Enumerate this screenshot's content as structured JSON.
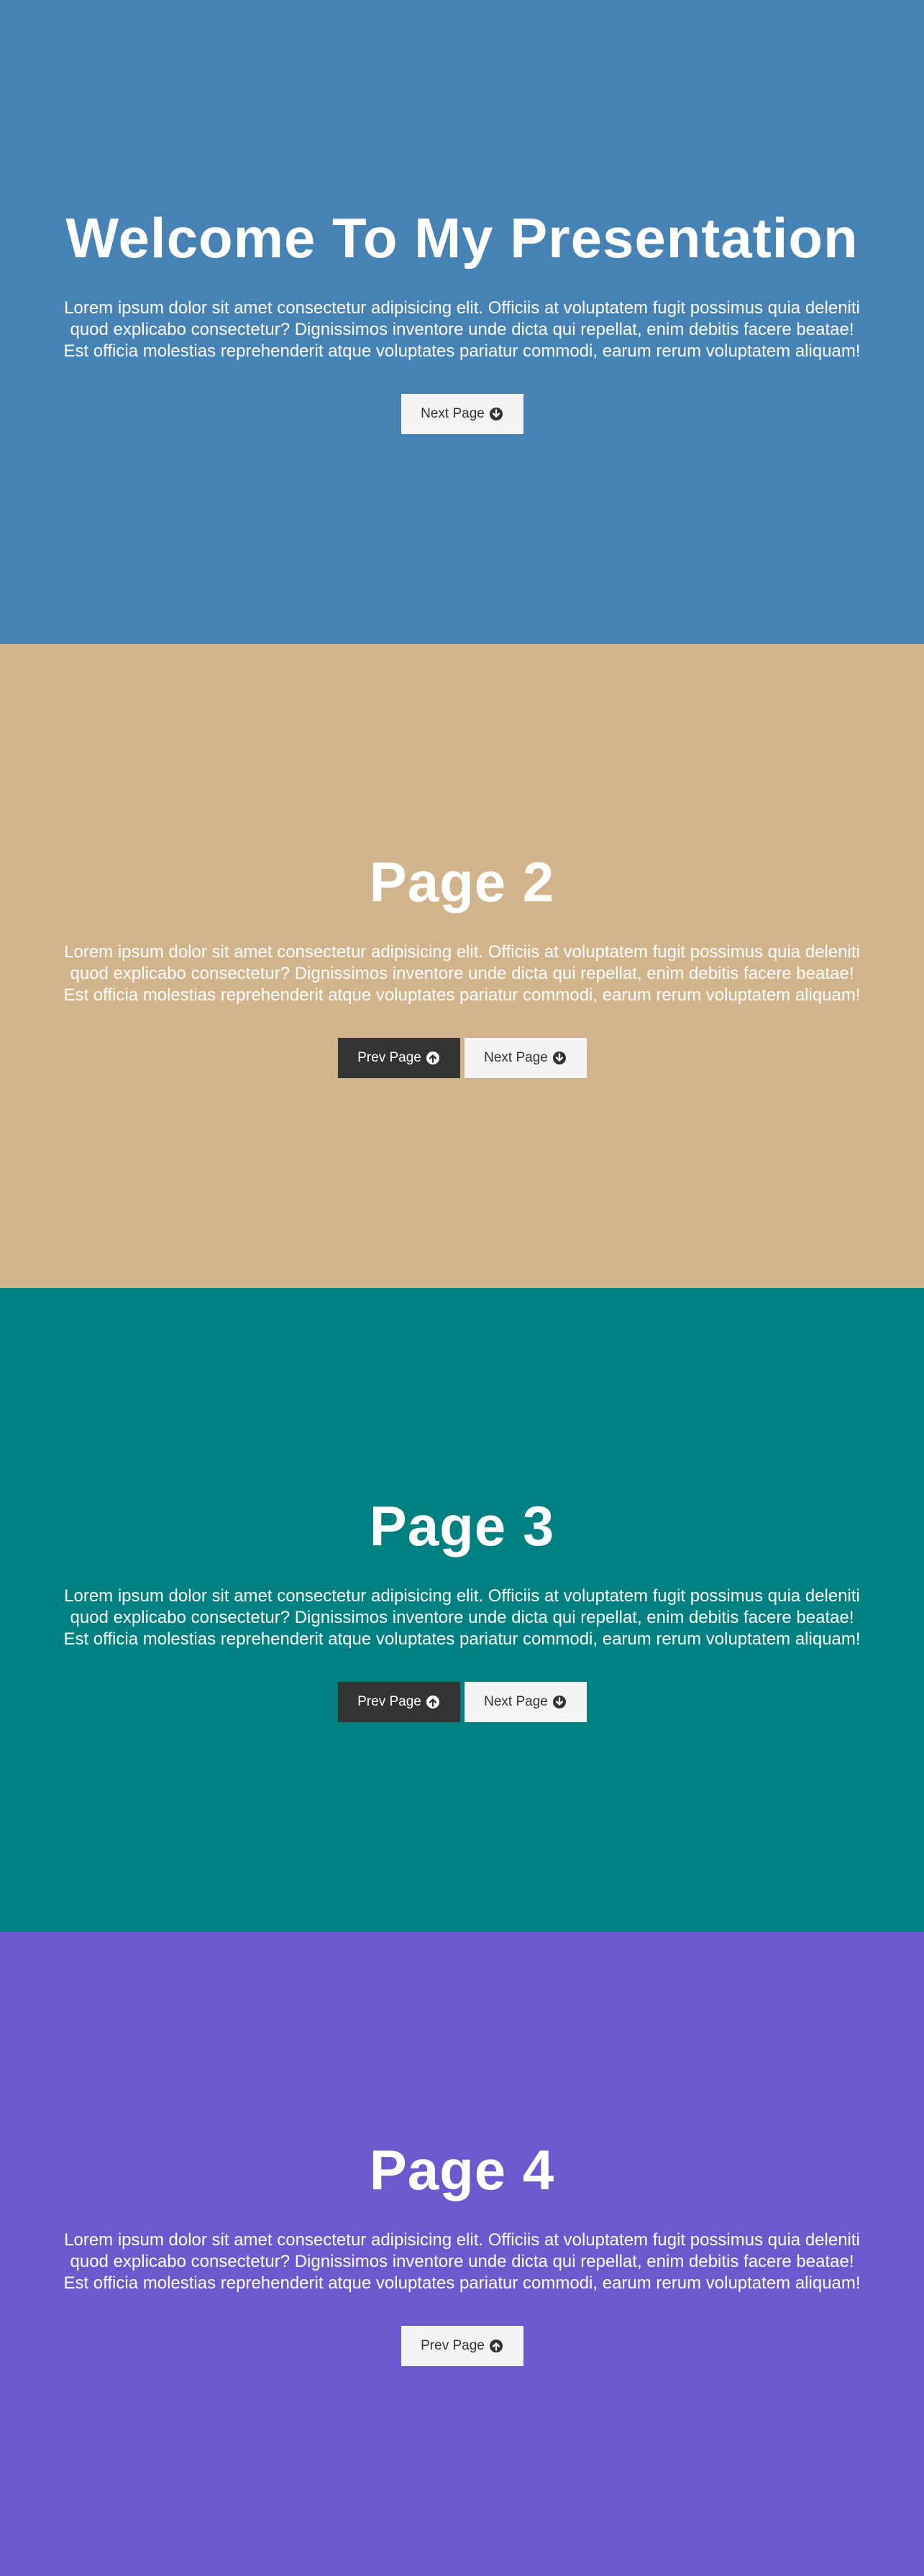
{
  "sections": [
    {
      "title": "Welcome To My Presentation",
      "text": "Lorem ipsum dolor sit amet consectetur adipisicing elit. Officiis at voluptatem fugit possimus quia deleniti quod explicabo consectetur? Dignissimos inventore unde dicta qui repellat, enim debitis facere beatae! Est officia molestias reprehenderit atque voluptates pariatur commodi, earum rerum voluptatem aliquam!",
      "background": "#4682b4",
      "next_label": "Next Page"
    },
    {
      "title": "Page 2",
      "text": "Lorem ipsum dolor sit amet consectetur adipisicing elit. Officiis at voluptatem fugit possimus quia deleniti quod explicabo consectetur? Dignissimos inventore unde dicta qui repellat, enim debitis facere beatae! Est officia molestias reprehenderit atque voluptates pariatur commodi, earum rerum voluptatem aliquam!",
      "background": "#d2b48c",
      "prev_label": "Prev Page",
      "next_label": "Next Page"
    },
    {
      "title": "Page 3",
      "text": "Lorem ipsum dolor sit amet consectetur adipisicing elit. Officiis at voluptatem fugit possimus quia deleniti quod explicabo consectetur? Dignissimos inventore unde dicta qui repellat, enim debitis facere beatae! Est officia molestias reprehenderit atque voluptates pariatur commodi, earum rerum voluptatem aliquam!",
      "background": "#008080",
      "prev_label": "Prev Page",
      "next_label": "Next Page"
    },
    {
      "title": "Page 4",
      "text": "Lorem ipsum dolor sit amet consectetur adipisicing elit. Officiis at voluptatem fugit possimus quia deleniti quod explicabo consectetur? Dignissimos inventore unde dicta qui repellat, enim debitis facere beatae! Est officia molestias reprehenderit atque voluptates pariatur commodi, earum rerum voluptatem aliquam!",
      "background": "#6a5acd",
      "prev_label": "Prev Page"
    }
  ],
  "icons": {
    "next": "arrow-circle-down-icon",
    "prev": "arrow-circle-up-icon"
  },
  "colors": {
    "button_light_bg": "#f4f4f4",
    "button_light_text": "#333333",
    "button_dark_bg": "#333333",
    "button_dark_text": "#ffffff"
  }
}
